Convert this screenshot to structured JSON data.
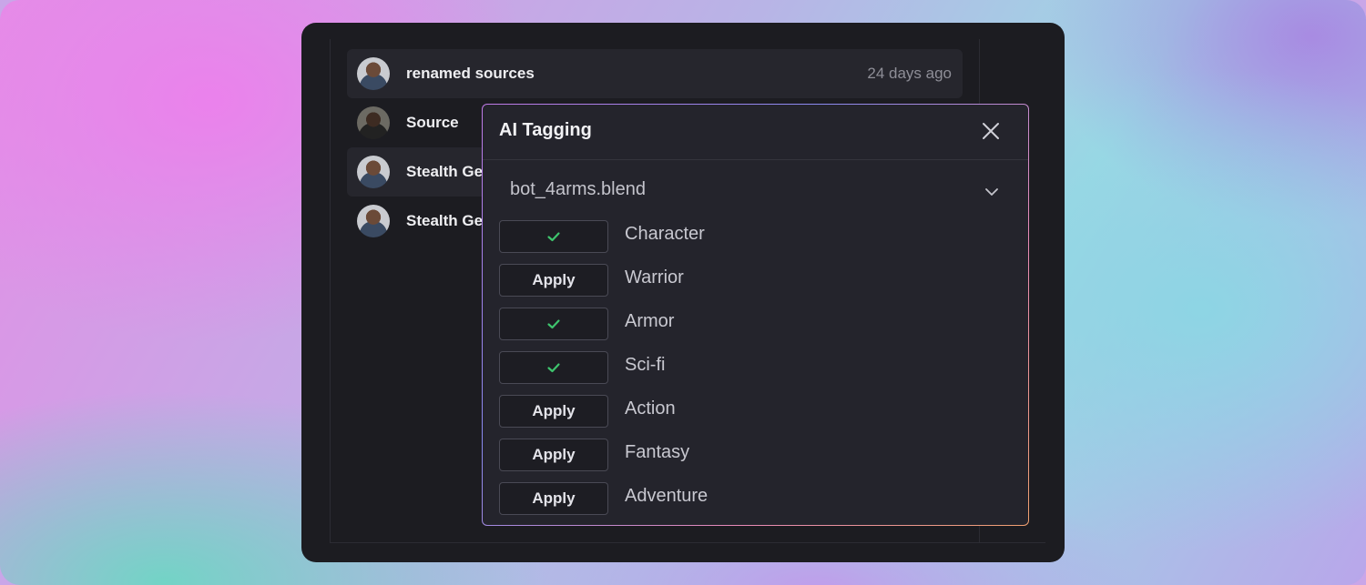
{
  "commits": [
    {
      "message": "renamed sources",
      "time": "24 days ago",
      "highlighted": true,
      "avatar": "avatar-man-blue-shirt"
    },
    {
      "message": "Source",
      "time": "",
      "highlighted": false,
      "avatar": "avatar-man-dark"
    },
    {
      "message": "Stealth Ge",
      "time": "",
      "highlighted": true,
      "avatar": "avatar-man-blue-shirt"
    },
    {
      "message": "Stealth Ge",
      "time": "",
      "highlighted": false,
      "avatar": "avatar-man-blue-shirt"
    }
  ],
  "modal": {
    "title": "AI Tagging",
    "close_icon": "close-icon",
    "file": {
      "name": "bot_4arms.blend",
      "dropdown_icon": "chevron-down-icon"
    },
    "tags": [
      {
        "label": "Character",
        "state": "applied",
        "button_label": ""
      },
      {
        "label": "Warrior",
        "state": "apply",
        "button_label": "Apply"
      },
      {
        "label": "Armor",
        "state": "applied",
        "button_label": ""
      },
      {
        "label": "Sci-fi",
        "state": "applied",
        "button_label": ""
      },
      {
        "label": "Action",
        "state": "apply",
        "button_label": "Apply"
      },
      {
        "label": "Fantasy",
        "state": "apply",
        "button_label": "Apply"
      },
      {
        "label": "Adventure",
        "state": "apply",
        "button_label": "Apply"
      }
    ]
  },
  "colors": {
    "check": "#3ec46d",
    "modal_border_gradient": [
      "#c07ae6",
      "#8a8af0",
      "#e88ab8",
      "#f0a070"
    ]
  }
}
